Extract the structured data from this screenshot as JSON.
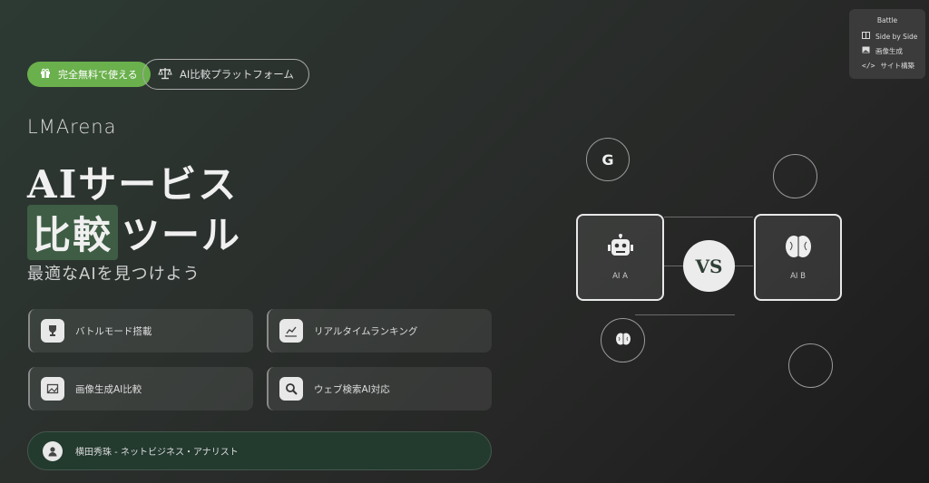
{
  "badges": {
    "free": "完全無料で使える",
    "platform": "AI比較プラットフォーム"
  },
  "brand": "LMArena",
  "headline": {
    "line1": "AIサービス",
    "line2_highlight": "比較",
    "line2_rest": "ツール"
  },
  "subtitle": "最適なAIを見つけよう",
  "features": [
    {
      "label": "バトルモード搭載",
      "icon": "trophy-icon"
    },
    {
      "label": "リアルタイムランキング",
      "icon": "chart-icon"
    },
    {
      "label": "画像生成AI比較",
      "icon": "image-icon"
    },
    {
      "label": "ウェブ検索AI対応",
      "icon": "search-icon"
    }
  ],
  "author": "横田秀珠 - ネットビジネス・アナリスト",
  "menu": {
    "title": "Battle",
    "items": [
      {
        "label": "Side by Side",
        "icon": "columns-icon"
      },
      {
        "label": "画像生成",
        "icon": "image-icon"
      },
      {
        "label": "サイト構築",
        "icon": "code-icon"
      }
    ]
  },
  "diagram": {
    "ai_a": "AI A",
    "ai_b": "AI B",
    "vs": "VS",
    "google_letter": "G"
  }
}
